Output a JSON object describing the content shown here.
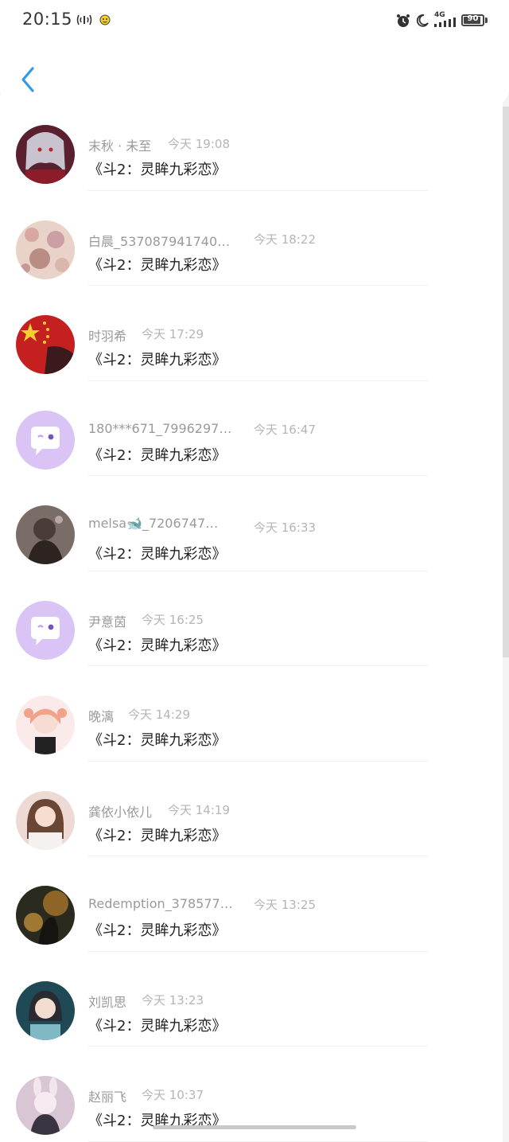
{
  "status_bar": {
    "time": "20:15",
    "network": "4G",
    "battery": "90",
    "battery_level": 0.9,
    "icons": [
      "signal-wave-icon",
      "mascot-icon",
      "alarm-icon",
      "moon-icon",
      "cell-signal-icon",
      "battery-icon"
    ]
  },
  "nav": {
    "back_icon": "chevron-left-icon",
    "accent_color": "#2f9be8"
  },
  "list": {
    "items": [
      {
        "nickname": "末秋 · 未至",
        "time": "今天 19:08",
        "message": "《斗2：灵眸九彩恋》",
        "avatar": "anime-girl-red"
      },
      {
        "nickname": "白晨_537087941740…",
        "time": "今天 18:22",
        "message": "《斗2：灵眸九彩恋》",
        "avatar": "blossom-photo"
      },
      {
        "nickname": "时羽希",
        "time": "今天 17:29",
        "message": "《斗2：灵眸九彩恋》",
        "avatar": "china-flag"
      },
      {
        "nickname": "180***671_7996297…",
        "time": "今天 16:47",
        "message": "《斗2：灵眸九彩恋》",
        "avatar": "default-chat"
      },
      {
        "nickname": "melsa🐋_7206747…",
        "time": "今天 16:33",
        "message": "《斗2：灵眸九彩恋》",
        "avatar": "dark-portrait"
      },
      {
        "nickname": "尹意茵",
        "time": "今天 16:25",
        "message": "《斗2：灵眸九彩恋》",
        "avatar": "default-chat"
      },
      {
        "nickname": "晚漓",
        "time": "今天 14:29",
        "message": "《斗2：灵眸九彩恋》",
        "avatar": "anime-girl-pink"
      },
      {
        "nickname": "龚依小依儿",
        "time": "今天 14:19",
        "message": "《斗2：灵眸九彩恋》",
        "avatar": "girl-portrait"
      },
      {
        "nickname": "Redemption_378577…",
        "time": "今天 13:25",
        "message": "《斗2：灵眸九彩恋》",
        "avatar": "fire-scene"
      },
      {
        "nickname": "刘凯思",
        "time": "今天 13:23",
        "message": "《斗2：灵眸九彩恋》",
        "avatar": "teal-portrait"
      },
      {
        "nickname": "赵丽飞",
        "time": "今天 10:37",
        "message": "《斗2：灵眸九彩恋》",
        "avatar": "bunny-girl"
      }
    ]
  }
}
